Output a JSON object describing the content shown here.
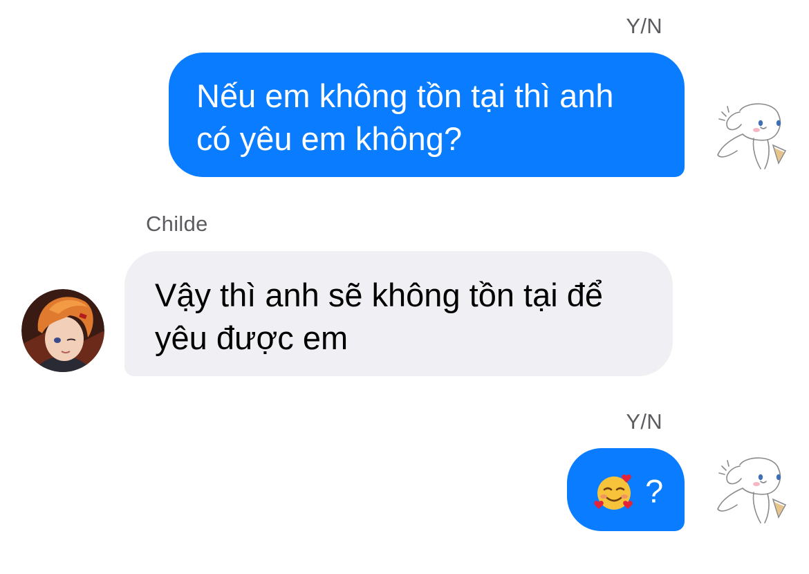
{
  "conversation": {
    "messages": [
      {
        "sender": "Y/N",
        "text": "Nếu em không tồn tại thì anh có yêu em không?",
        "direction": "outgoing"
      },
      {
        "sender": "Childe",
        "text": "Vậy thì anh sẽ không tồn tại để yêu được em",
        "direction": "incoming"
      },
      {
        "sender": "Y/N",
        "emoji": "smiling-face-with-hearts",
        "text": "?",
        "direction": "outgoing"
      }
    ]
  },
  "theme": {
    "outgoing_bubble": "#0a7cff",
    "incoming_bubble": "#f0f0f4",
    "sender_name_color": "#5b5b60"
  }
}
